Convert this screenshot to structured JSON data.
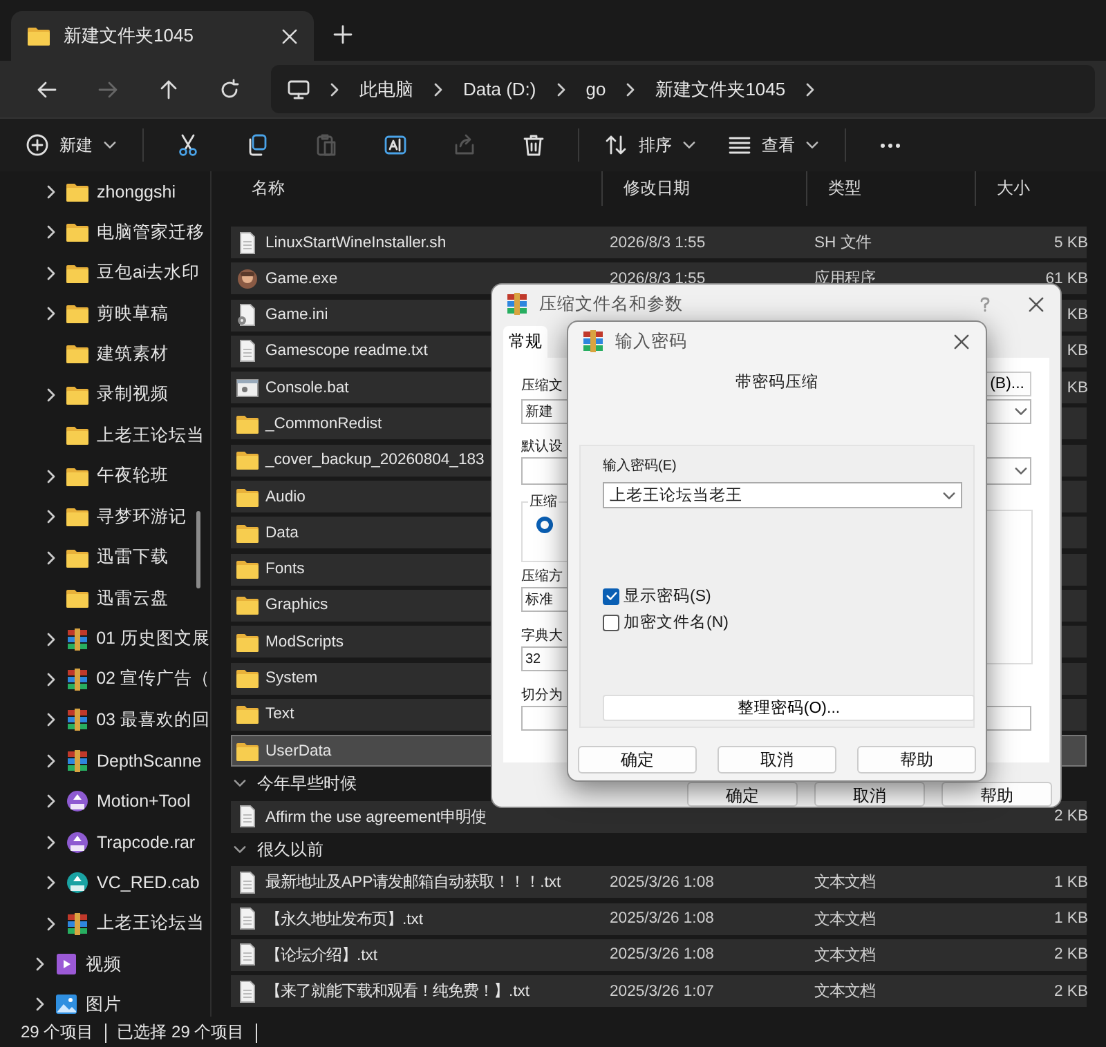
{
  "tab": {
    "title": "新建文件夹1045"
  },
  "nav": [
    {
      "kind": "back",
      "disabled": false
    },
    {
      "kind": "forward",
      "disabled": true
    },
    {
      "kind": "up",
      "disabled": false
    },
    {
      "kind": "refresh",
      "disabled": false
    }
  ],
  "address": {
    "crumbs": [
      "此电脑",
      "Data (D:)",
      "go",
      "新建文件夹1045"
    ]
  },
  "toolbar": [
    {
      "kind": "new",
      "label": "新建",
      "disabled": false
    },
    {
      "kind": "cut",
      "disabled": false
    },
    {
      "kind": "copy",
      "disabled": false
    },
    {
      "kind": "paste",
      "disabled": true
    },
    {
      "kind": "rename",
      "disabled": false
    },
    {
      "kind": "share",
      "disabled": true
    },
    {
      "kind": "delete",
      "disabled": false
    },
    {
      "kind": "sort",
      "label": "排序",
      "disabled": false
    },
    {
      "kind": "view",
      "label": "查看",
      "disabled": false
    },
    {
      "kind": "more",
      "disabled": false
    }
  ],
  "sidebar": {
    "items": [
      {
        "children": [
          {
            "label": "zhonggshi",
            "kind": "folder",
            "expandable": true
          },
          {
            "label": "电脑管家迁移",
            "kind": "folder",
            "expandable": true
          },
          {
            "label": "豆包ai去水印",
            "kind": "folder",
            "expandable": true
          },
          {
            "label": "剪映草稿",
            "kind": "folder",
            "expandable": true
          },
          {
            "label": "建筑素材",
            "kind": "folder",
            "expandable": false
          },
          {
            "label": "录制视频",
            "kind": "folder",
            "expandable": true
          },
          {
            "label": "上老王论坛当",
            "kind": "folder",
            "expandable": false
          },
          {
            "label": "午夜轮班",
            "kind": "folder",
            "expandable": true
          },
          {
            "label": "寻梦环游记",
            "kind": "folder",
            "expandable": true
          },
          {
            "label": "迅雷下载",
            "kind": "folder",
            "expandable": true
          },
          {
            "label": "迅雷云盘",
            "kind": "folder",
            "expandable": false
          },
          {
            "label": "01 历史图文展",
            "kind": "rar",
            "expandable": true
          },
          {
            "label": "02 宣传广告（",
            "kind": "rar",
            "expandable": true
          },
          {
            "label": "03 最喜欢的回",
            "kind": "rar",
            "expandable": true
          },
          {
            "label": "DepthScanne",
            "kind": "rar",
            "expandable": true
          },
          {
            "label": "Motion+Tool",
            "kind": "rar-disk",
            "expandable": true
          },
          {
            "label": "Trapcode.rar",
            "kind": "rar-disk",
            "expandable": true
          },
          {
            "label": "VC_RED.cab",
            "kind": "cab",
            "expandable": true
          },
          {
            "label": "上老王论坛当",
            "kind": "rar",
            "expandable": true
          }
        ]
      },
      {
        "label": "视频",
        "kind": "video",
        "expandable": true
      },
      {
        "label": "图片",
        "kind": "picture",
        "expandable": true
      }
    ]
  },
  "file_list": {
    "columns": [
      "名称",
      "修改日期",
      "类型",
      "大小"
    ],
    "sections": [
      {
        "rows": [
          {
            "name": "LinuxStartWineInstaller.sh",
            "date": "2026/8/3 1:55",
            "type": "SH 文件",
            "size": "5 KB",
            "kind": "doc",
            "selected": true,
            "focused": false
          },
          {
            "name": "Game.exe",
            "date": "2026/8/3 1:55",
            "type": "应用程序",
            "size": "61 KB",
            "kind": "exe",
            "selected": true,
            "focused": false
          },
          {
            "name": "Game.ini",
            "size": "KB",
            "kind": "ini",
            "selected": true,
            "focused": false
          },
          {
            "name": "Gamescope readme.txt",
            "size": "KB",
            "kind": "doc",
            "selected": true,
            "focused": false
          },
          {
            "name": "Console.bat",
            "size": "KB",
            "kind": "bat",
            "selected": true,
            "focused": false
          },
          {
            "name": "_CommonRedist",
            "kind": "folder",
            "selected": true,
            "focused": false
          },
          {
            "name": "_cover_backup_20260804_183",
            "kind": "folder",
            "selected": true,
            "focused": false
          },
          {
            "name": "Audio",
            "kind": "folder",
            "selected": true,
            "focused": false
          },
          {
            "name": "Data",
            "kind": "folder",
            "selected": true,
            "focused": false
          },
          {
            "name": "Fonts",
            "kind": "folder",
            "selected": true,
            "focused": false
          },
          {
            "name": "Graphics",
            "kind": "folder",
            "selected": true,
            "focused": false
          },
          {
            "name": "ModScripts",
            "kind": "folder",
            "selected": true,
            "focused": false
          },
          {
            "name": "System",
            "kind": "folder",
            "selected": true,
            "focused": false
          },
          {
            "name": "Text",
            "kind": "folder",
            "selected": true,
            "focused": false
          },
          {
            "name": "UserData",
            "kind": "folder",
            "selected": true,
            "focused": true
          }
        ]
      },
      {
        "title": "今年早些时候",
        "expanded": true,
        "rows": [
          {
            "name": "Affirm the use agreement申明使",
            "size": "2 KB",
            "kind": "doc",
            "selected": true,
            "focused": false
          }
        ]
      },
      {
        "title": "很久以前",
        "expanded": true,
        "rows": [
          {
            "name": "最新地址及APP请发邮箱自动获取！！！.txt",
            "date": "2025/3/26 1:08",
            "type": "文本文档",
            "size": "1 KB",
            "kind": "doc",
            "selected": true,
            "focused": false
          },
          {
            "name": "【永久地址发布页】.txt",
            "date": "2025/3/26 1:08",
            "type": "文本文档",
            "size": "1 KB",
            "kind": "doc",
            "selected": true,
            "focused": false
          },
          {
            "name": "【论坛介绍】.txt",
            "date": "2025/3/26 1:08",
            "type": "文本文档",
            "size": "2 KB",
            "kind": "doc",
            "selected": true,
            "focused": false
          },
          {
            "name": "【来了就能下载和观看！纯免费！】.txt",
            "date": "2025/3/26 1:07",
            "type": "文本文档",
            "size": "2 KB",
            "kind": "doc",
            "selected": true,
            "focused": false
          }
        ]
      }
    ]
  },
  "status_bar": {
    "count": "29 个项目",
    "selection": "已选择 29 个项目"
  },
  "archive_dialog": {
    "title": "压缩文件名和参数",
    "tabs": [
      {
        "label": "常规",
        "selected": true
      }
    ],
    "name_label": "压缩文",
    "browse_button": "(B)...",
    "name_value": "新建",
    "profile_label": "默认设",
    "format_group_label": "压缩",
    "format_radio_selected": true,
    "method_label": "压缩方",
    "method_value": "标准",
    "dict_label": "字典大",
    "dict_value": "32",
    "split_label": "切分为",
    "buttons": [
      "确定",
      "取消",
      "帮助"
    ]
  },
  "password_dialog": {
    "title": "输入密码",
    "heading": "带密码压缩",
    "field_label": "输入密码(E)",
    "password": "上老王论坛当老王",
    "options": [
      {
        "label": "显示密码(S)",
        "checked": true
      },
      {
        "label": "加密文件名(N)",
        "checked": false
      }
    ],
    "organize_button": "整理密码(O)...",
    "buttons": [
      "确定",
      "取消",
      "帮助"
    ]
  }
}
